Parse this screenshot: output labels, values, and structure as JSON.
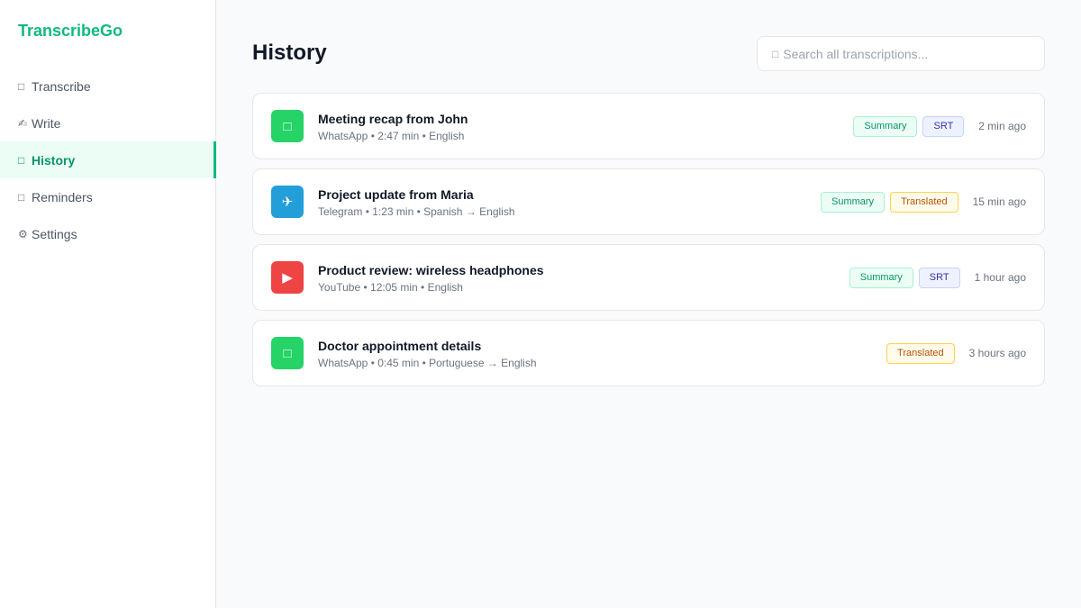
{
  "app": {
    "name": "TranscribeGo"
  },
  "nav": [
    {
      "icon": "microphone-icon",
      "glyph": "□",
      "label": "Transcribe",
      "active": false
    },
    {
      "icon": "pen-icon",
      "glyph": "✍",
      "label": "Write",
      "active": false
    },
    {
      "icon": "history-icon",
      "glyph": "□",
      "label": "History",
      "active": true
    },
    {
      "icon": "bell-icon",
      "glyph": "□",
      "label": "Reminders",
      "active": false
    },
    {
      "icon": "gear-icon",
      "glyph": "⚙",
      "label": "Settings",
      "active": false
    }
  ],
  "page": {
    "title": "History"
  },
  "search": {
    "placeholder": "Search all transcriptions...",
    "value": "",
    "icon": "search-icon"
  },
  "colors": {
    "brand": "#10b981",
    "whatsapp": "#25d366",
    "telegram": "#229ed9",
    "youtube": "#ef4444"
  },
  "items": [
    {
      "title": "Meeting recap from John",
      "meta": "WhatsApp • 2:47 min • English",
      "app_icon": "whatsapp-icon",
      "app_color": "#25d366",
      "glyph": "□",
      "tags": [
        {
          "label": "Summary",
          "kind": "summary"
        },
        {
          "label": "SRT",
          "kind": "srt"
        }
      ],
      "time": "2 min ago"
    },
    {
      "title": "Project update from Maria",
      "meta": "Telegram • 1:23 min • Spanish → English",
      "app_icon": "telegram-icon",
      "app_color": "#229ed9",
      "glyph": "✈",
      "tags": [
        {
          "label": "Summary",
          "kind": "summary"
        },
        {
          "label": "Translated",
          "kind": "translated"
        }
      ],
      "time": "15 min ago"
    },
    {
      "title": "Product review: wireless headphones",
      "meta": "YouTube • 12:05 min • English",
      "app_icon": "youtube-icon",
      "app_color": "#ef4444",
      "glyph": "▶",
      "tags": [
        {
          "label": "Summary",
          "kind": "summary"
        },
        {
          "label": "SRT",
          "kind": "srt"
        }
      ],
      "time": "1 hour ago"
    },
    {
      "title": "Doctor appointment details",
      "meta": "WhatsApp • 0:45 min • Portuguese → English",
      "app_icon": "whatsapp-icon",
      "app_color": "#25d366",
      "glyph": "□",
      "tags": [
        {
          "label": "Translated",
          "kind": "translated"
        }
      ],
      "time": "3 hours ago"
    }
  ]
}
